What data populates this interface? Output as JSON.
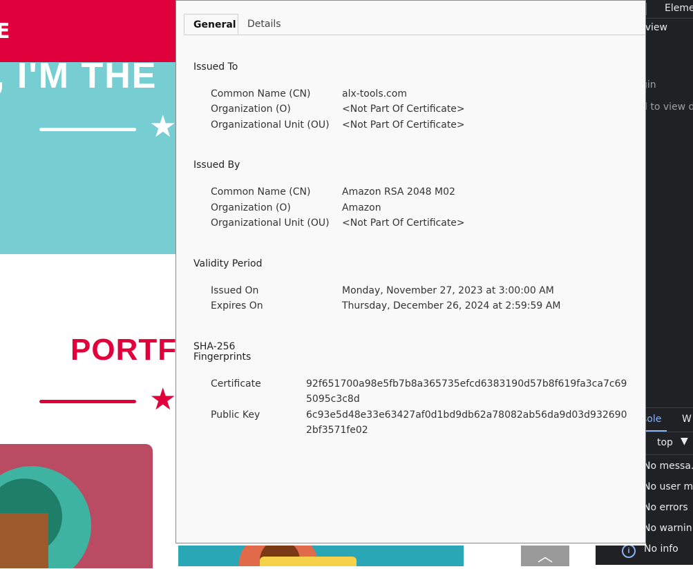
{
  "background_site": {
    "menu_glyph": "E",
    "hero_title": ", I'M THE",
    "hero_star": "★",
    "portfolio_title": "PORTF",
    "portfolio_star": "★",
    "scroll_top_icon": "chevron-up-icon",
    "accent_color": "#e0003b",
    "hero_color": "#76ced3"
  },
  "devtools": {
    "tab_elements": "Eleme",
    "overview": "rview",
    "origin": "gin",
    "reload_hint": "d to view d",
    "console_tab": "sole",
    "whats_new_tab": "W",
    "context": "top",
    "rows": [
      {
        "label": "No messa..."
      },
      {
        "label": "No user m"
      },
      {
        "label": "No errors"
      },
      {
        "label": "No warnin"
      }
    ],
    "info_row": "No info",
    "info_icon": "info-icon"
  },
  "certificate": {
    "tabs": [
      "General",
      "Details"
    ],
    "active_tab": "General",
    "issued_to": {
      "title": "Issued To",
      "fields": [
        {
          "label": "Common Name (CN)",
          "value": "alx-tools.com"
        },
        {
          "label": "Organization (O)",
          "value": "<Not Part Of Certificate>"
        },
        {
          "label": "Organizational Unit (OU)",
          "value": "<Not Part Of Certificate>"
        }
      ]
    },
    "issued_by": {
      "title": "Issued By",
      "fields": [
        {
          "label": "Common Name (CN)",
          "value": "Amazon RSA 2048 M02"
        },
        {
          "label": "Organization (O)",
          "value": "Amazon"
        },
        {
          "label": "Organizational Unit (OU)",
          "value": "<Not Part Of Certificate>"
        }
      ]
    },
    "validity": {
      "title": "Validity Period",
      "fields": [
        {
          "label": "Issued On",
          "value": "Monday, November 27, 2023 at 3:00:00 AM"
        },
        {
          "label": "Expires On",
          "value": "Thursday, December 26, 2024 at 2:59:59 AM"
        }
      ]
    },
    "fingerprints": {
      "title_line1": "SHA-256",
      "title_line2": "Fingerprints",
      "fields": [
        {
          "label": "Certificate",
          "value": "92f651700a98e5fb7b8a365735efcd6383190d57b8f619fa3ca7c695095c3c8d"
        },
        {
          "label": "Public Key",
          "value": "6c93e5d48e33e63427af0d1bd9db62a78082ab56da9d03d9326902bf3571fe02"
        }
      ]
    }
  }
}
